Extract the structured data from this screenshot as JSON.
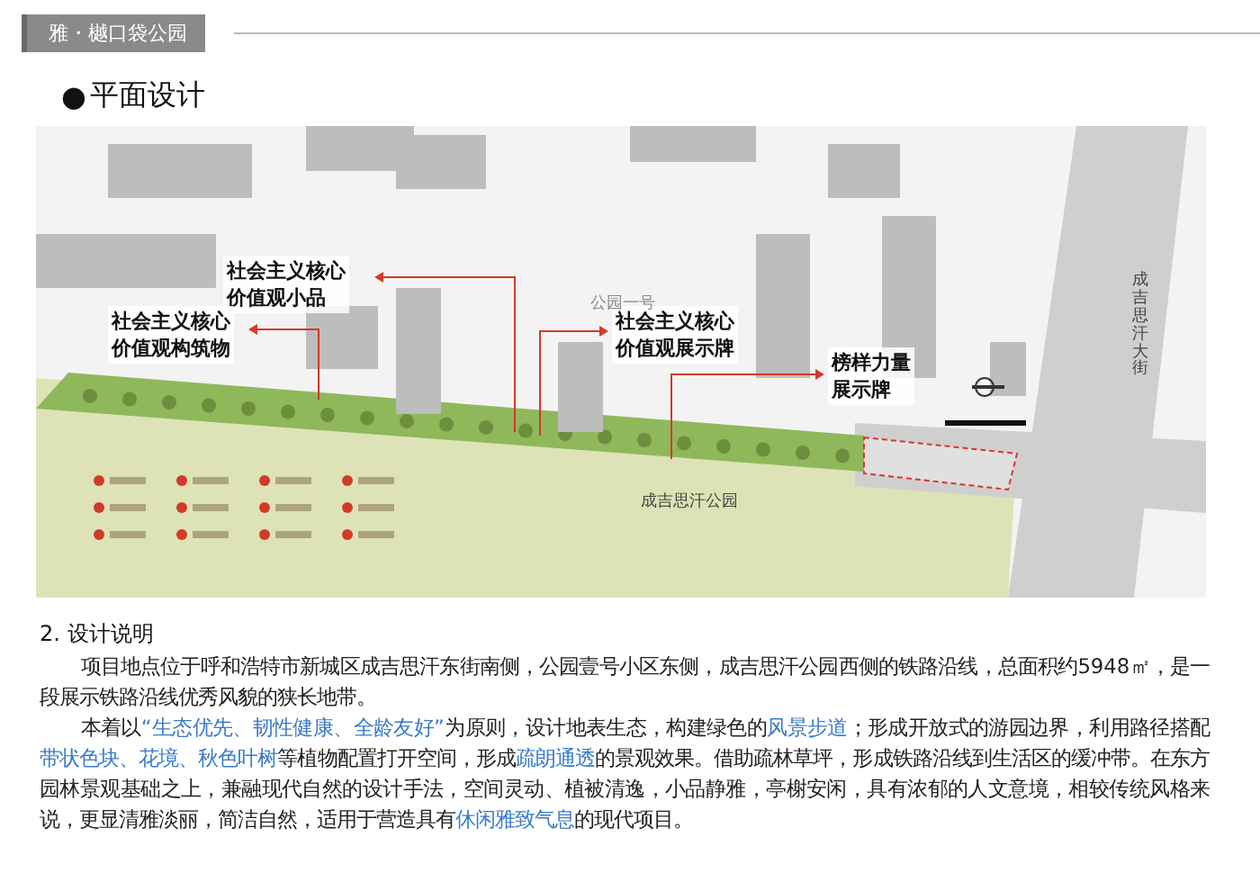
{
  "header": {
    "title": "雅・樾口袋公园"
  },
  "section": {
    "bullet": "●",
    "title": "平面设计"
  },
  "plan": {
    "callouts": [
      {
        "lines": [
          "社会主义核心",
          "价值观小品"
        ]
      },
      {
        "lines": [
          "社会主义核心",
          "价值观构筑物"
        ]
      },
      {
        "lines": [
          "社会主义核心",
          "价值观展示牌"
        ]
      },
      {
        "lines": [
          "榜样力量",
          "展示牌"
        ]
      }
    ],
    "place_label": "公园一号",
    "park_label": "成吉思汗公园",
    "street_label": "成吉思汗大街"
  },
  "description": {
    "heading": "2. 设计说明",
    "paragraphs": [
      "项目地点位于呼和浩特市新城区成吉思汗东街南侧，公园壹号小区东侧，成吉思汗公园西侧的铁路沿线，总面积约5948㎡，是一段展示铁路沿线优秀风貌的狭长地带。",
      "本着以**“生态优先、韧性健康、全龄友好”**为原则，设计地表生态，构建绿色的**风景步道**；形成开放式的游园边界，利用路径搭配**带状色块、花境、秋色叶树**等植物配置打开空间，形成**疏朗通透**的景观效果。借助疏林草坪，形成铁路沿线到生活区的缓冲带。在东方园林景观基础之上，兼融现代自然的设计手法，空间灵动、植被清逸，小品静雅，亭榭安闲，具有浓郁的人文意境，相较传统风格来说，更显清雅淡丽，简洁自然，适用于营造具有**休闲雅致气息**的现代项目。"
    ]
  }
}
